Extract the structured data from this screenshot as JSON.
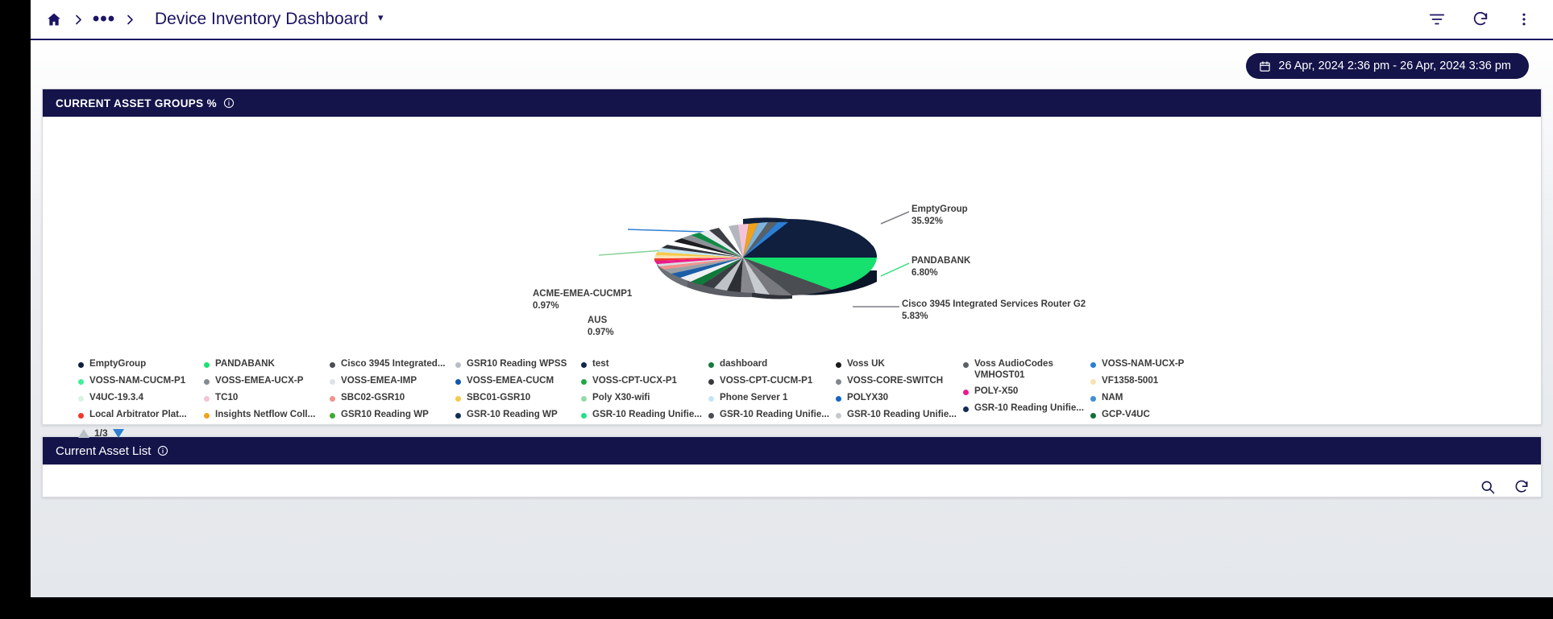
{
  "topbar": {
    "home_icon": "home-icon",
    "ellipsis": "•••",
    "title": "Device Inventory Dashboard",
    "title_caret": "▾",
    "actions": [
      {
        "name": "filter-icon",
        "label": "Filter"
      },
      {
        "name": "refresh-icon",
        "label": "Refresh"
      },
      {
        "name": "more-options-icon",
        "label": "More options"
      }
    ]
  },
  "date_range": {
    "text": "26 Apr, 2024 2:36 pm - 26 Apr, 2024 3:36 pm",
    "icon": "calendar-icon"
  },
  "asset_groups_panel": {
    "title": "CURRENT ASSET GROUPS %",
    "info_icon": "info-icon"
  },
  "asset_list_panel": {
    "title": "Current Asset List",
    "info_icon": "info-icon",
    "tools": [
      {
        "name": "search-icon",
        "label": "Search"
      },
      {
        "name": "refresh-icon",
        "label": "Refresh"
      }
    ]
  },
  "pager": {
    "up_label": "previous page",
    "text": "1/3",
    "down_label": "next page"
  },
  "chart_data": {
    "type": "pie",
    "title": "CURRENT ASSET GROUPS %",
    "unit": "%",
    "three_d": true,
    "callouts": [
      {
        "label": "ACME-EMEA-CUCMP1",
        "value": "0.97%"
      },
      {
        "label": "AUS",
        "value": "0.97%"
      },
      {
        "label": "EmptyGroup",
        "value": "35.92%"
      },
      {
        "label": "PANDABANK",
        "value": "6.80%"
      },
      {
        "label": "Cisco 3945 Integrated Services Router G2",
        "value": "5.83%"
      }
    ],
    "categories": [
      "EmptyGroup",
      "PANDABANK",
      "Cisco 3945 Integrated Services Router G2",
      "GSR10 Reading WPSS",
      "test",
      "dashboard",
      "Voss UK",
      "Voss AudioCodes VMHOST01",
      "VOSS-NAM-UCX-P",
      "VOSS-NAM-CUCM-P1",
      "VOSS-EMEA-UCX-P",
      "VOSS-EMEA-IMP",
      "VOSS-EMEA-CUCM",
      "VOSS-CPT-UCX-P1",
      "VOSS-CPT-CUCM-P1",
      "VOSS-CORE-SWITCH",
      "VF1358-5001",
      "V4UC-19.3.4",
      "TC10",
      "SBC02-GSR10",
      "SBC01-GSR10",
      "Poly X30-wifi",
      "Phone Server 1",
      "POLYX30",
      "POLY-X50",
      "NAM",
      "Local Arbitrator Plat...",
      "Insights Netflow Coll...",
      "GSR10 Reading WP",
      "GSR-10 Reading WP",
      "GSR-10 Reading Unifie...",
      "GCP-V4UC",
      "ACME-EMEA-CUCMP1",
      "AUS"
    ],
    "values": [
      35.92,
      6.8,
      5.83,
      0.97,
      0.97,
      0.97,
      0.97,
      0.97,
      0.97,
      0.97,
      0.97,
      0.97,
      0.97,
      0.97,
      0.97,
      0.97,
      0.97,
      0.97,
      0.97,
      0.97,
      0.97,
      0.97,
      0.97,
      0.97,
      0.97,
      0.97,
      0.97,
      0.97,
      0.97,
      0.97,
      0.97,
      0.97,
      0.97,
      0.97
    ],
    "legend_position": "bottom",
    "legend_pages": "1/3"
  },
  "legend": {
    "columns": [
      {
        "items": [
          {
            "label": "EmptyGroup",
            "color": "#0f1f3d"
          },
          {
            "label": "VOSS-NAM-CUCM-P1",
            "color": "#3ff09b"
          },
          {
            "label": "V4UC-19.3.4",
            "color": "#d8f3e2"
          },
          {
            "label": "Local Arbitrator Plat...",
            "color": "#f0372b"
          }
        ]
      },
      {
        "items": [
          {
            "label": "PANDABANK",
            "color": "#1ee073"
          },
          {
            "label": "VOSS-EMEA-UCX-P",
            "color": "#848a90"
          },
          {
            "label": "TC10",
            "color": "#f4c3d8"
          },
          {
            "label": "Insights Netflow Coll...",
            "color": "#f0a21c"
          }
        ]
      },
      {
        "items": [
          {
            "label": "Cisco 3945 Integrated...",
            "color": "#4b4f54"
          },
          {
            "label": "VOSS-EMEA-IMP",
            "color": "#dfe2e6"
          },
          {
            "label": "SBC02-GSR10",
            "color": "#f2928d"
          },
          {
            "label": "GSR10 Reading WP",
            "color": "#3faa32"
          }
        ]
      },
      {
        "items": [
          {
            "label": "GSR10 Reading WPSS",
            "color": "#b8bdc4"
          },
          {
            "label": "VOSS-EMEA-CUCM",
            "color": "#1257b0"
          },
          {
            "label": "SBC01-GSR10",
            "color": "#f6c94a"
          },
          {
            "label": "GSR-10 Reading WP",
            "color": "#122e52"
          }
        ]
      },
      {
        "items": [
          {
            "label": "test",
            "color": "#12284a"
          },
          {
            "label": "VOSS-CPT-UCX-P1",
            "color": "#1fa84a"
          },
          {
            "label": "Poly X30-wifi",
            "color": "#93dca8"
          },
          {
            "label": "GSR-10 Reading Unifie...",
            "color": "#22e08a"
          }
        ]
      },
      {
        "items": [
          {
            "label": "dashboard",
            "color": "#177b3e"
          },
          {
            "label": "VOSS-CPT-CUCM-P1",
            "color": "#38393c"
          },
          {
            "label": "Phone Server 1",
            "color": "#c7e5f7"
          },
          {
            "label": "GSR-10 Reading Unifie...",
            "color": "#4a4d52"
          }
        ]
      },
      {
        "items": [
          {
            "label": "Voss UK",
            "color": "#1a1a1a"
          },
          {
            "label": "VOSS-CORE-SWITCH",
            "color": "#83878d"
          },
          {
            "label": "POLYX30",
            "color": "#1566c5"
          },
          {
            "label": "GSR-10 Reading Unifie...",
            "color": "#c5c9ce"
          }
        ]
      },
      {
        "items": [
          {
            "label": "Voss AudioCodes VMHOST01",
            "color": "#5b6066",
            "wrap": true
          },
          {
            "label": "POLY-X50",
            "color": "#ec1a8c"
          },
          {
            "label": "GSR-10 Reading Unifie...",
            "color": "#132b55"
          }
        ]
      },
      {
        "items": [
          {
            "label": "VOSS-NAM-UCX-P",
            "color": "#2a7fd4"
          },
          {
            "label": "VF1358-5001",
            "color": "#fae2b4"
          },
          {
            "label": "NAM",
            "color": "#3f8fd8"
          },
          {
            "label": "GCP-V4UC",
            "color": "#12703e"
          }
        ]
      }
    ]
  }
}
